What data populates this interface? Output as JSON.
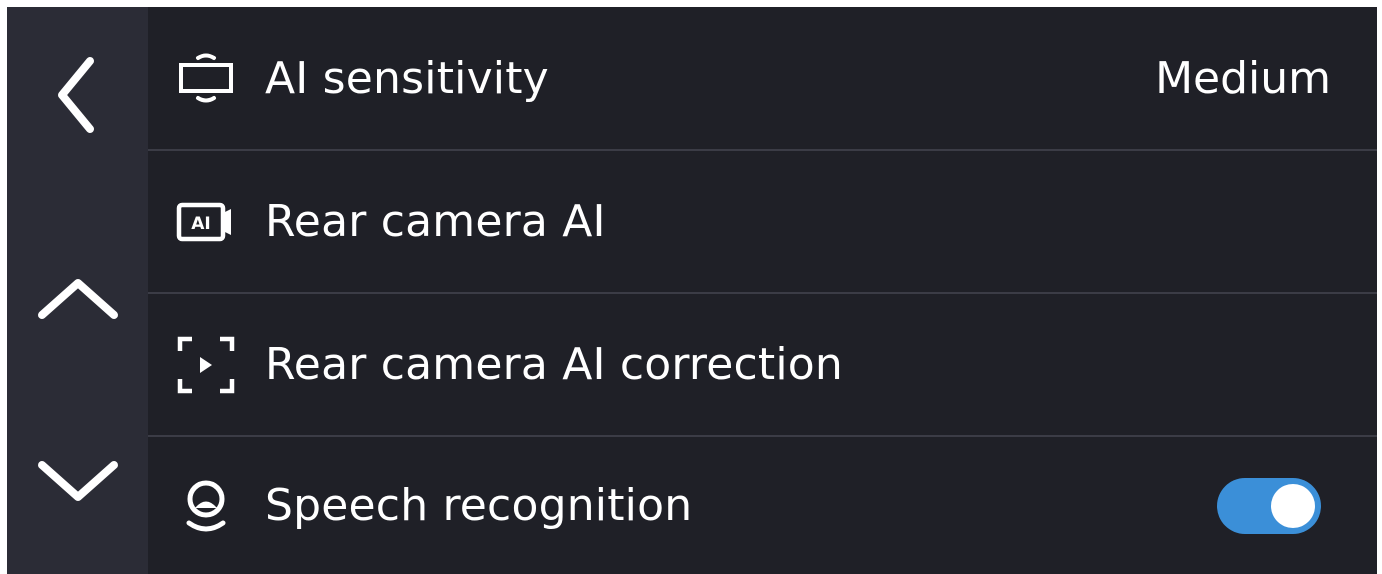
{
  "colors": {
    "background": "#1f2027",
    "sidebar": "#2b2c36",
    "divider": "#3b3c46",
    "text": "#ffffff",
    "toggle_on": "#3b8fd8"
  },
  "sidebar": {
    "back_icon": "chevron-left-icon",
    "up_icon": "chevron-up-icon",
    "down_icon": "chevron-down-icon"
  },
  "settings": {
    "items": [
      {
        "icon": "ai-sensitivity-icon",
        "label": "AI sensitivity",
        "value": "Medium"
      },
      {
        "icon": "ai-camera-icon",
        "label": "Rear camera AI"
      },
      {
        "icon": "camera-correction-icon",
        "label": "Rear camera AI correction"
      },
      {
        "icon": "speech-recognition-icon",
        "label": "Speech recognition",
        "toggle_state": "on"
      }
    ]
  }
}
